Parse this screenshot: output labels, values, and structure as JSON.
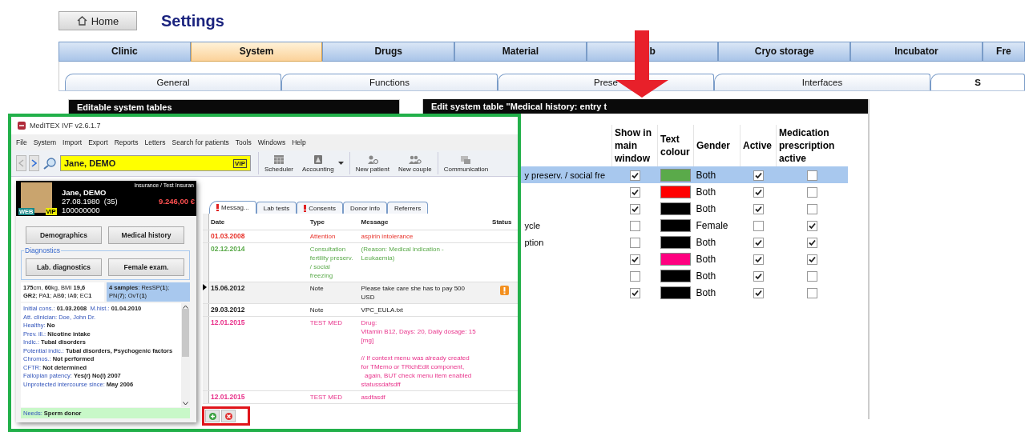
{
  "home_button": "Home",
  "title": "Settings",
  "main_tabs": [
    {
      "label": "Clinic",
      "selected": false
    },
    {
      "label": "System",
      "selected": true
    },
    {
      "label": "Drugs",
      "selected": false
    },
    {
      "label": "Material",
      "selected": false
    },
    {
      "label": "b",
      "selected": false
    },
    {
      "label": "Cryo storage",
      "selected": false
    },
    {
      "label": "Incubator",
      "selected": false
    },
    {
      "label": "Fre",
      "selected": false
    }
  ],
  "sub_tabs": [
    {
      "label": "General",
      "selected": false
    },
    {
      "label": "Functions",
      "selected": false
    },
    {
      "label": "Prese",
      "selected": false
    },
    {
      "label": "Interfaces",
      "selected": false
    },
    {
      "label": "S",
      "selected": true
    }
  ],
  "left_panel": {
    "title": "Editable system tables"
  },
  "edit_panel": {
    "title": "Edit system table \"Medical history: entry t",
    "columns": [
      "Show in main window",
      "Text colour",
      "Gender",
      "Active",
      "Medication prescription active"
    ],
    "rows": [
      {
        "column_1": "y preserv. / social fre",
        "show_in_main_window": true,
        "color": "#5aaa4a",
        "gender": "Both",
        "active": true,
        "medication_prescription_active": false,
        "selected": true
      },
      {
        "show_in_main_window": true,
        "color": "#ff0000",
        "gender": "Both",
        "active": true,
        "medication_prescription_active": false,
        "selected": false
      },
      {
        "show_in_main_window": true,
        "color": "#000000",
        "gender": "Both",
        "active": true,
        "medication_prescription_active": false,
        "selected": false
      },
      {
        "column_1": "ycle",
        "show_in_main_window": false,
        "color": "#000000",
        "gender": "Female",
        "active": false,
        "medication_prescription_active": true,
        "selected": false
      },
      {
        "column_1": "ption",
        "show_in_main_window": false,
        "color": "#000000",
        "gender": "Both",
        "active": true,
        "medication_prescription_active": true,
        "selected": false
      },
      {
        "show_in_main_window": true,
        "color": "#ff0080",
        "gender": "Both",
        "active": true,
        "medication_prescription_active": true,
        "selected": false
      },
      {
        "show_in_main_window": false,
        "color": "#000000",
        "gender": "Both",
        "active": true,
        "medication_prescription_active": false,
        "selected": false
      },
      {
        "show_in_main_window": true,
        "color": "#000000",
        "gender": "Both",
        "active": true,
        "medication_prescription_active": false,
        "selected": false
      }
    ]
  },
  "inset": {
    "title": "MedITEX IVF v2.6.1.7",
    "menu": [
      "File",
      "System",
      "Import",
      "Export",
      "Reports",
      "Letters",
      "Search for patients",
      "Tools",
      "Windows",
      "Help"
    ],
    "patient_field": {
      "value": "Jane, DEMO",
      "badge": "VIP"
    },
    "toolbar": [
      {
        "label": "Scheduler",
        "kind": "scheduler",
        "dropdown": false
      },
      {
        "label": "Accounting",
        "kind": "accounting",
        "dropdown": true
      },
      {
        "label": "New patient",
        "kind": "patient",
        "dropdown": false
      },
      {
        "label": "New couple",
        "kind": "couple",
        "dropdown": false
      },
      {
        "label": "Communication",
        "kind": "communication",
        "dropdown": false
      }
    ],
    "card": {
      "insurance": "Insurance / Test Insuran",
      "name": "Jane, DEMO",
      "birth": "27.08.1980",
      "age": "(35)",
      "balance": "9.246,00 €",
      "number": "100000000",
      "badges": [
        "WEB",
        "VIP"
      ],
      "buttons": [
        "Demographics",
        "Medical history"
      ],
      "group": {
        "title": "Diagnostics",
        "buttons": [
          "Lab. diagnostics",
          "Female exam."
        ]
      },
      "vitals": [
        "**175**cm, **60**kg, BMI **19,6**",
        "**GR2**; PA**1**; AB**0**; IA**0**; EC**1**"
      ],
      "samples": "**4 samples**: ResSP(**1**); PN(**7**); OvT(**1**)",
      "history": [
        [
          {
            "label": "Initial cons.:",
            "value": "01.03.2008",
            "kind": "bold"
          },
          {
            "label": "M.hist.:",
            "value": "01.04.2010",
            "kind": "bold"
          }
        ],
        [
          {
            "label": "Att. clinician:",
            "value": "Doe, John Dr.",
            "kind": "link"
          }
        ],
        [
          {
            "label": "Healthy:",
            "value": "No",
            "kind": "bold"
          }
        ],
        [
          {
            "label": "Prev. ill.:",
            "value": "Nicotine intake",
            "kind": "bold"
          }
        ],
        [
          {
            "label": "Indic.:",
            "value": "Tubal disorders",
            "kind": "bold"
          }
        ],
        [
          {
            "label": "Potential indic.:",
            "value": "Tubal disorders, Psychogenic factors",
            "kind": "bold"
          }
        ],
        [
          {
            "label": "Chromos.:",
            "value": "Not performed",
            "kind": "bold"
          }
        ],
        [
          {
            "label": "CFTR:",
            "value": "Not determined",
            "kind": "bold"
          }
        ],
        [
          {
            "label": "Fallopian patency:",
            "value": "Yes(r) No(l) 2007",
            "kind": "bold"
          }
        ],
        [
          {
            "label": "Unprotected intercourse since:",
            "value": "May 2006",
            "kind": "bold"
          }
        ]
      ],
      "needs": {
        "label": "Needs:",
        "value": "Sperm donor"
      }
    },
    "tabs": [
      {
        "label": "Messag...",
        "alert": true,
        "selected": true
      },
      {
        "label": "Lab tests",
        "alert": false,
        "selected": false
      },
      {
        "label": "Consents",
        "alert": true,
        "selected": false
      },
      {
        "label": "Donor info",
        "alert": false,
        "selected": false
      },
      {
        "label": "Referrers",
        "alert": false,
        "selected": false
      }
    ],
    "grid": {
      "columns": [
        "Date",
        "Type",
        "Message",
        "Status"
      ],
      "rows": [
        {
          "date": "01.03.2008",
          "type": "Attention",
          "message": "aspirin intolerance",
          "color": "#e8322a",
          "selected": false,
          "warning": false
        },
        {
          "date": "02.12.2014",
          "type": "Consultation\nfertility preserv.\n/ social\nfreezing",
          "message": "(Reason: Medical indication -\nLeukaemia)",
          "color": "#5aaa4a",
          "selected": false,
          "warning": false
        },
        {
          "date": "15.06.2012",
          "type": "Note",
          "message": "Please take care she has to pay 500\nUSD",
          "color": "#222222",
          "selected": true,
          "warning": true
        },
        {
          "date": "29.03.2012",
          "type": "Note",
          "message": "VPC_EULA.txt",
          "color": "#222222",
          "selected": false,
          "warning": false
        },
        {
          "date": "12.01.2015",
          "type": "TEST MED",
          "message": "Drug:\nVitamin B12, Days: 20, Daily dosage: 15\n[mg]\n\n// If context menu was already created\nfor TMemo or TRichEdit component,\n  again, BUT check menu item enabled\nstatussdafsdff",
          "color": "#e8318a",
          "selected": false,
          "warning": false
        },
        {
          "date": "12.01.2015",
          "type": "TEST MED",
          "message": "asdfasdf",
          "color": "#e8318a",
          "selected": false,
          "warning": false
        }
      ]
    }
  }
}
